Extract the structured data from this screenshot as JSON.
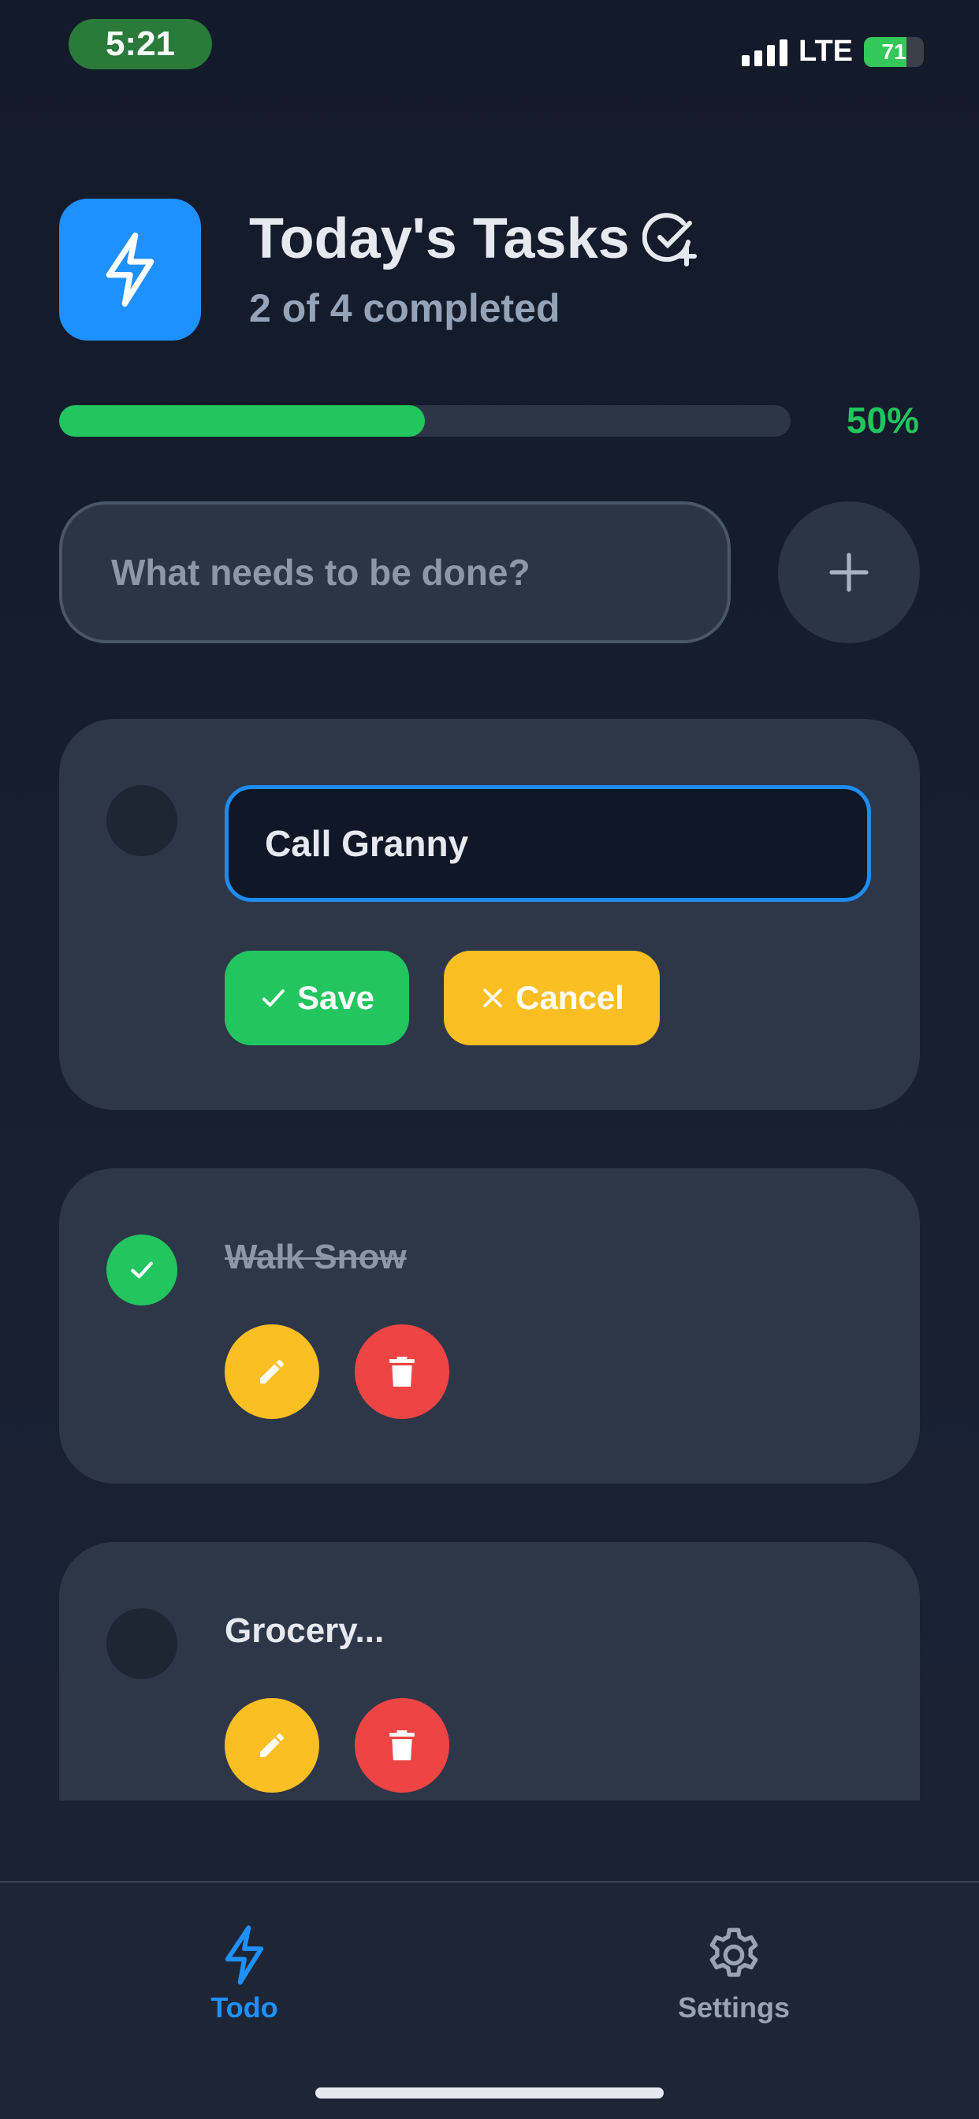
{
  "status_bar": {
    "time": "5:21",
    "network": "LTE",
    "battery_percent": "71",
    "battery_level": 0.71
  },
  "header": {
    "title": "Today's Tasks",
    "subtitle": "2 of 4 completed",
    "app_icon": "lightning-icon",
    "title_icon": "check-plus-icon"
  },
  "progress": {
    "value": 0.5,
    "label": "50%"
  },
  "new_task": {
    "placeholder": "What needs to be done?",
    "value": ""
  },
  "tasks": [
    {
      "editing": true,
      "edit_value": "Call Granny",
      "completed": false,
      "save_label": "Save",
      "cancel_label": "Cancel"
    },
    {
      "title": "Walk Snow",
      "completed": true
    },
    {
      "title": "Grocery...",
      "completed": false
    }
  ],
  "tabbar": {
    "tabs": [
      {
        "label": "Todo",
        "icon": "lightning-icon",
        "active": true
      },
      {
        "label": "Settings",
        "icon": "gear-icon",
        "active": false
      }
    ]
  },
  "colors": {
    "accent": "#1e90ff",
    "success": "#22c55e",
    "warning": "#fbbf24",
    "danger": "#ef4444",
    "background": "#141b2b",
    "card": "#2e3748"
  }
}
